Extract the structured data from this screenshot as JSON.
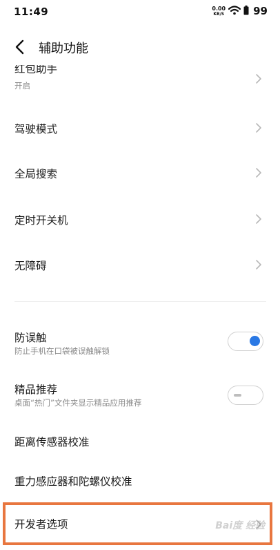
{
  "status_bar": {
    "time": "11:49",
    "net_speed_value": "0.00",
    "net_speed_unit": "KB/S",
    "battery": "99"
  },
  "header": {
    "title": "辅助功能"
  },
  "rows": [
    {
      "label": "红包助手",
      "sub": "开启"
    },
    {
      "label": "驾驶模式"
    },
    {
      "label": "全局搜索"
    },
    {
      "label": "定时开关机"
    },
    {
      "label": "无障碍"
    }
  ],
  "toggles": [
    {
      "label": "防误触",
      "sub": "防止手机在口袋被误触解锁",
      "on": true
    },
    {
      "label": "精品推荐",
      "sub": "桌面“热门”文件夹显示精品应用推荐",
      "on": false
    }
  ],
  "plain_rows": [
    {
      "label": "距离传感器校准"
    },
    {
      "label": "重力感应器和陀螺仪校准"
    }
  ],
  "developer_row": {
    "label": "开发者选项"
  },
  "highlight_color": "#e8763f",
  "accent_color": "#2a78e4",
  "watermark": "Bai度 经验"
}
